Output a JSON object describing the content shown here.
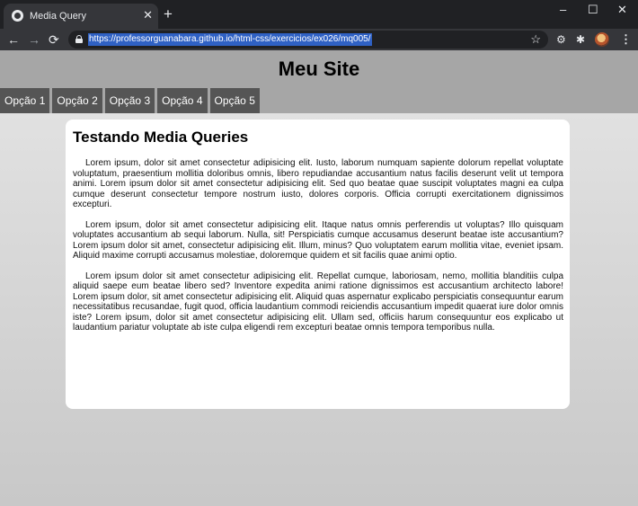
{
  "browser": {
    "tab": {
      "title": "Media Query",
      "close": "✕"
    },
    "new_tab": "+",
    "window": {
      "minimize": "–",
      "maximize": "☐",
      "close": "✕"
    },
    "nav": {
      "back": "←",
      "forward": "→",
      "reload": "⟳"
    },
    "url": "https://professorguanabara.github.io/html-css/exercicios/ex026/mq005/",
    "bookmark": "☆",
    "extensions": [
      "⚙",
      "✱"
    ],
    "menu": "⋮",
    "icons": [
      "globe-icon",
      "lock-icon",
      "star-icon",
      "gear-icon",
      "puzzle-icon",
      "avatar-icon"
    ]
  },
  "page": {
    "site_title": "Meu Site",
    "menu": [
      "Opção 1",
      "Opção 2",
      "Opção 3",
      "Opção 4",
      "Opção 5"
    ],
    "content_title": "Testando Media Queries",
    "paragraphs": [
      "Lorem ipsum, dolor sit amet consectetur adipisicing elit. Iusto, laborum numquam sapiente dolorum repellat voluptate voluptatum, praesentium mollitia doloribus omnis, libero repudiandae accusantium natus facilis deserunt velit ut tempora animi. Lorem ipsum dolor sit amet consectetur adipisicing elit. Sed quo beatae quae suscipit voluptates magni ea culpa cumque deserunt consectetur tempore nostrum iusto, dolores corporis. Officia corrupti exercitationem dignissimos excepturi.",
      "Lorem ipsum, dolor sit amet consectetur adipisicing elit. Itaque natus omnis perferendis ut voluptas? Illo quisquam voluptates accusantium ab sequi laborum. Nulla, sit! Perspiciatis cumque accusamus deserunt beatae iste accusantium? Lorem ipsum dolor sit amet, consectetur adipisicing elit. Illum, minus? Quo voluptatem earum mollitia vitae, eveniet ipsam. Aliquid maxime corrupti accusamus molestiae, doloremque quidem et sit facilis quae animi optio.",
      "Lorem ipsum dolor sit amet consectetur adipisicing elit. Repellat cumque, laboriosam, nemo, mollitia blanditiis culpa aliquid saepe eum beatae libero sed? Inventore expedita animi ratione dignissimos est accusantium architecto labore! Lorem ipsum dolor, sit amet consectetur adipisicing elit. Aliquid quas aspernatur explicabo perspiciatis consequuntur earum necessitatibus recusandae, fugit quod, officia laudantium commodi reiciendis accusantium impedit quaerat iure dolor omnis iste? Lorem ipsum, dolor sit amet consectetur adipisicing elit. Ullam sed, officiis harum consequuntur eos explicabo ut laudantium pariatur voluptate ab iste culpa eligendi rem excepturi beatae omnis tempora temporibus nulla."
    ]
  }
}
